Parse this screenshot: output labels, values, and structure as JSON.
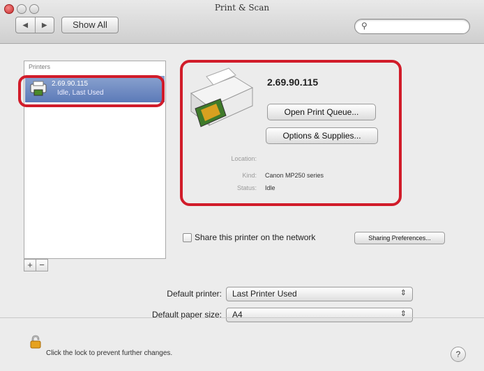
{
  "window": {
    "title": "Print & Scan"
  },
  "toolbar": {
    "back_glyph": "◀",
    "forward_glyph": "▶",
    "show_all_label": "Show All",
    "search_icon": "search-icon",
    "search_glyph": "⚲",
    "search_value": ""
  },
  "printers_list": {
    "header": "Printers",
    "items": [
      {
        "name": "2.69.90.115",
        "status": "Idle, Last Used"
      }
    ],
    "add_glyph": "+",
    "remove_glyph": "−"
  },
  "details": {
    "printer_name": "2.69.90.115",
    "open_queue_label": "Open Print Queue...",
    "options_label": "Options & Supplies...",
    "location_label": "Location:",
    "location_value": "",
    "kind_label": "Kind:",
    "kind_value": "Canon MP250 series",
    "status_label": "Status:",
    "status_value": "Idle"
  },
  "sharing": {
    "share_label": "Share this printer on the network",
    "share_checked": false,
    "preferences_label": "Sharing Preferences..."
  },
  "defaults": {
    "default_printer_label": "Default printer:",
    "default_printer_value": "Last Printer Used",
    "default_paper_label": "Default paper size:",
    "default_paper_value": "A4",
    "popup_arrows": "⇕"
  },
  "footer": {
    "lock_text": "Click the lock to prevent further changes.",
    "help_label": "?"
  },
  "colors": {
    "highlight": "#d11c2a",
    "selection": "#5c7ab8"
  }
}
